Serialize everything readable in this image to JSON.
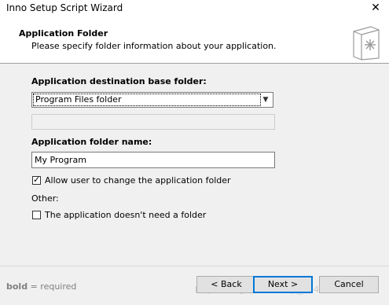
{
  "window": {
    "title": "Inno Setup Script Wizard",
    "close_glyph": "✕"
  },
  "header": {
    "title": "Application Folder",
    "subtitle": "Please specify folder information about your application."
  },
  "form": {
    "dest_label": "Application destination base folder:",
    "dest_selected": "Program Files folder",
    "folder_name_label": "Application folder name:",
    "folder_name_value": "My Program",
    "allow_change_label": "Allow user to change the application folder",
    "allow_change_checked": true,
    "other_label": "Other:",
    "no_folder_label": "The application doesn't need a folder",
    "no_folder_checked": false
  },
  "footer": {
    "bold_word": "bold",
    "note_rest": " = required",
    "back_label": "< Back",
    "next_label": "Next >",
    "cancel_label": "Cancel",
    "watermark": "https://blog.csdn.net/qq_39411082"
  }
}
